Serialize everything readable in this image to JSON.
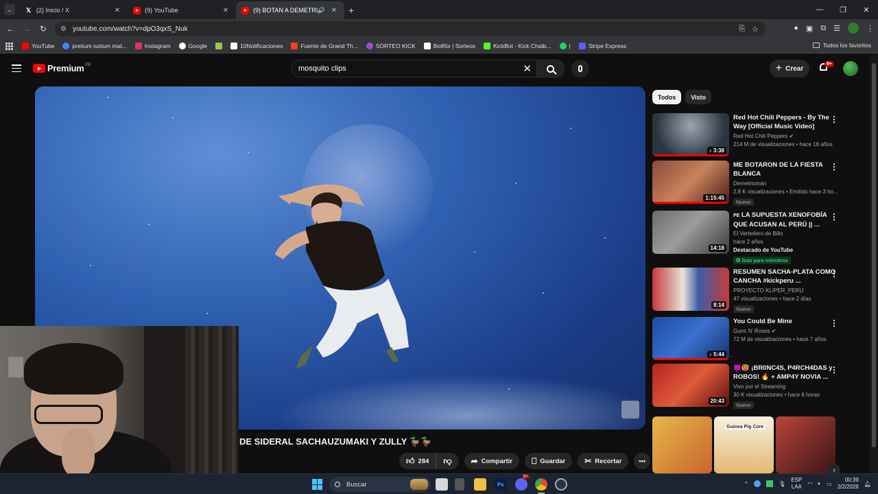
{
  "browser": {
    "tabs": [
      {
        "title": "(2) Inicio / X",
        "favicon": "x-logo"
      },
      {
        "title": "(9) YouTube",
        "favicon": "youtube-logo"
      },
      {
        "title": "(9) BOTAN A DEMETRIOMA",
        "favicon": "youtube-logo",
        "active": true,
        "audio": true
      }
    ],
    "url": "youtube.com/watch?v=dpO3qxS_Nuk",
    "bookmarks": [
      {
        "label": "YouTube",
        "color": "#ff0000"
      },
      {
        "label": "pretium iustum mat...",
        "color": "#4285f4"
      },
      {
        "label": "Instagram",
        "color": "#e1306c"
      },
      {
        "label": "Google",
        "color": "#ffffff"
      },
      {
        "label": "",
        "color": "#9cc34a"
      },
      {
        "label": "10Notificaciones",
        "color": "#ffffff"
      },
      {
        "label": "Fuente de Grand Th...",
        "color": "#ff3b1f"
      },
      {
        "label": "SORTEO KICK",
        "color": "#a14bd1"
      },
      {
        "label": "BotRix | Sorteos",
        "color": "#ffffff"
      },
      {
        "label": "KickBot - Kick Chatb...",
        "color": "#53fc18"
      },
      {
        "label": "|",
        "color": "#25d366"
      },
      {
        "label": "Stripe Express",
        "color": "#635bff"
      }
    ],
    "all_bookmarks": "Todos los favoritos"
  },
  "youtube": {
    "logo": "Premium",
    "country": "PE",
    "search_value": "mosquito clips",
    "create_label": "Crear",
    "notif_badge": "9+",
    "video_title": "DE SIDERAL SACHAUZUMAKI Y ZULLY 🦆🦆",
    "actions": {
      "likes": "284",
      "share": "Compartir",
      "save": "Guardar",
      "clip": "Recortar"
    },
    "chips": [
      "Todos",
      "Visto"
    ],
    "recommendations": [
      {
        "title": "Red Hot Chili Peppers - By The Way [Official Music Video]",
        "channel": "Red Hot Chili Peppers",
        "verified": true,
        "meta": "214 M de visualizaciones • hace 16 años",
        "duration": "3:38",
        "music": true,
        "thumb": "#3d4a55",
        "progress": 1.0
      },
      {
        "title": "ME BOTARON DE LA FIESTA BLANCA",
        "channel": "Demetrioman",
        "meta": "2,8 K visualizaciones • Emitido hace 3 ho...",
        "duration": "1:15:45",
        "badge": "Nuevo",
        "thumb": "#7a3b2a",
        "progress": 1.0
      },
      {
        "title": "LA SUPUESTA XENOFOBÍA QUE ACUSAN AL PERÚ || ...",
        "channel": "El Vertedero de Billo",
        "meta": "hace 2 años",
        "duration": "14:18",
        "featured": "Destacado de YouTube",
        "members": "Solo para miembros",
        "prefix": "PE",
        "thumb": "#5a5a5a"
      },
      {
        "title": "RESUMEN SACHA-PLATA COMO CANCHA  #kickperu ...",
        "channel": "PROYECTO KLIPER_PERU",
        "meta": "47 visualizaciones • hace 2 días",
        "duration": "8:14",
        "badge": "Nuevo",
        "thumb": "#b83a3a"
      },
      {
        "title": "You Could Be Mine",
        "channel": "Guns N' Roses",
        "verified": true,
        "meta": "72 M de visualizaciones • hace 7 años",
        "duration": "5:44",
        "music": true,
        "thumb": "#2f5aa8",
        "progress": 1.0
      },
      {
        "title": "😈🥵 ¡BR0NC4S, P4RCH4DAS y ROBOS! 🔥 + AMP4Y NOVIA ...",
        "channel": "Vivo por el Streaming",
        "meta": "30 K visualizaciones • hace 8 horas",
        "duration": "20:43",
        "badge": "Nuevo",
        "thumb": "#9e1f1f"
      }
    ],
    "shorts": [
      {
        "label": "",
        "color": "#e6b84a"
      },
      {
        "label": "Guinea Pig Core",
        "color": "#f0d9a8"
      },
      {
        "label": "",
        "color": "#7a2e2e"
      }
    ]
  },
  "taskbar": {
    "search": "Buscar",
    "lang_top": "ESP",
    "lang_bottom": "LAA",
    "time": "00:39",
    "date": "2/2/2026",
    "discord_badge": "9+"
  }
}
